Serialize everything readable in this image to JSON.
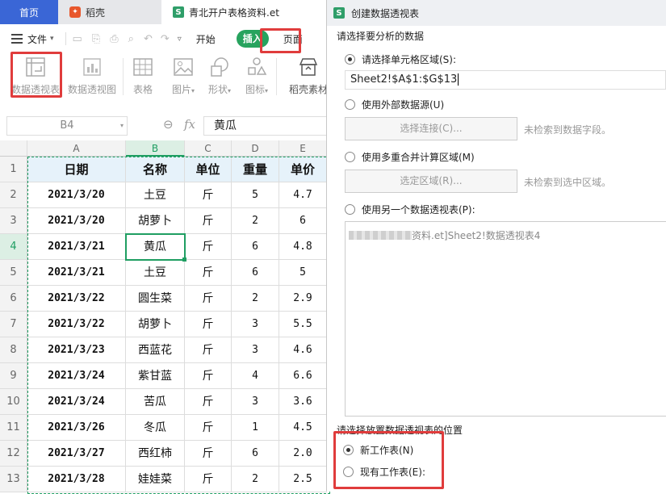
{
  "tabs": {
    "home": "首页",
    "daoke": "稻壳",
    "file": "青北开户表格资料.et"
  },
  "menubar": {
    "file_menu": "文件",
    "start": "开始",
    "insert": "插入",
    "page": "页面"
  },
  "ribbon": {
    "pivot_table": "数据透视表",
    "pivot_chart": "数据透视图",
    "table": "表格",
    "picture": "图片",
    "shape": "形状",
    "icon": "图标",
    "daoke_material": "稻壳素材"
  },
  "formula_bar": {
    "cell_ref": "B4",
    "fx": "fx",
    "value": "黄瓜"
  },
  "sheet": {
    "columns": [
      "A",
      "B",
      "C",
      "D",
      "E"
    ],
    "row_numbers": [
      "1",
      "2",
      "3",
      "4",
      "5",
      "6",
      "7",
      "8",
      "9",
      "10",
      "11",
      "12",
      "13"
    ],
    "rows": [
      [
        "日期",
        "名称",
        "单位",
        "重量",
        "单价"
      ],
      [
        "2021/3/20",
        "土豆",
        "斤",
        "5",
        "4.7"
      ],
      [
        "2021/3/20",
        "胡萝卜",
        "斤",
        "2",
        "6"
      ],
      [
        "2021/3/21",
        "黄瓜",
        "斤",
        "6",
        "4.8"
      ],
      [
        "2021/3/21",
        "土豆",
        "斤",
        "6",
        "5"
      ],
      [
        "2021/3/22",
        "圆生菜",
        "斤",
        "2",
        "2.9"
      ],
      [
        "2021/3/22",
        "胡萝卜",
        "斤",
        "3",
        "5.5"
      ],
      [
        "2021/3/23",
        "西蓝花",
        "斤",
        "3",
        "4.6"
      ],
      [
        "2021/3/24",
        "紫甘蓝",
        "斤",
        "4",
        "6.6"
      ],
      [
        "2021/3/24",
        "苦瓜",
        "斤",
        "3",
        "3.6"
      ],
      [
        "2021/3/26",
        "冬瓜",
        "斤",
        "1",
        "4.5"
      ],
      [
        "2021/3/27",
        "西红柿",
        "斤",
        "6",
        "2.0"
      ],
      [
        "2021/3/28",
        "娃娃菜",
        "斤",
        "2",
        "2.5"
      ]
    ]
  },
  "dialog": {
    "title": "创建数据透视表",
    "section1": "请选择要分析的数据",
    "opt_range": "请选择单元格区域(S):",
    "range_value": "Sheet2!$A$1:$G$13",
    "opt_external": "使用外部数据源(U)",
    "btn_choose_conn": "选择连接(C)...",
    "hint_no_field": "未检索到数据字段。",
    "opt_multi": "使用多重合并计算区域(M)",
    "btn_choose_region": "选定区域(R)...",
    "hint_no_region": "未检索到选中区域。",
    "opt_other_pivot": "使用另一个数据透视表(P):",
    "pivot_list_item": "资料.et]Sheet2!数据透视表4",
    "section2": "请选择放置数据透视表的位置",
    "opt_new_sheet": "新工作表(N)",
    "opt_existing_sheet": "现有工作表(E):"
  },
  "colors": {
    "accent_blue": "#3a66d6",
    "insert_green": "#27a35e",
    "highlight_red": "#e03c3c",
    "selection_green": "#1f9e62",
    "excel_green": "#2f9e69"
  }
}
